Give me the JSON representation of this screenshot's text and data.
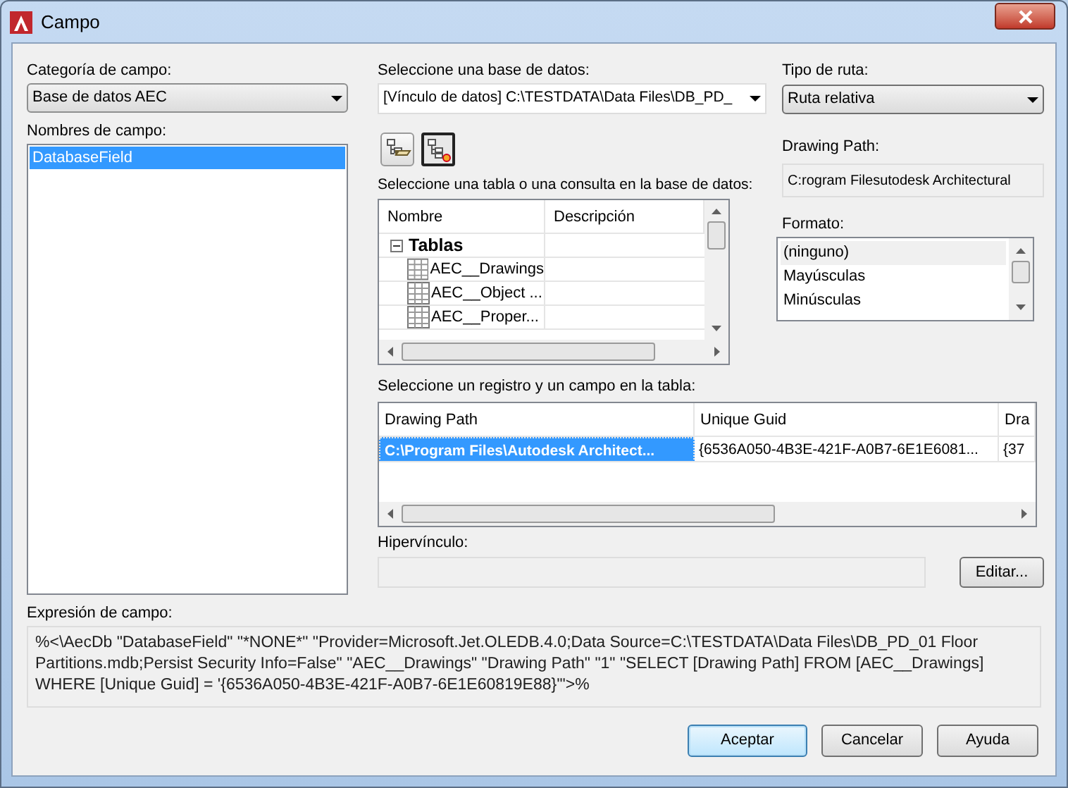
{
  "window": {
    "title": "Campo"
  },
  "field_category": {
    "label": "Categoría de campo:",
    "value": "Base de datos AEC"
  },
  "field_names": {
    "label": "Nombres de campo:",
    "items": [
      {
        "text": "DatabaseField",
        "selected": true
      }
    ]
  },
  "database": {
    "label": "Seleccione una base de datos:",
    "value": "[Vínculo de datos] C:\\TESTDATA\\Data Files\\DB_PD_"
  },
  "toolbar": [
    {
      "kind": "open",
      "pressed": false
    },
    {
      "kind": "new",
      "pressed": true
    }
  ],
  "table_query": {
    "label": "Seleccione una tabla o una consulta en la base de datos:",
    "columns": [
      "Nombre",
      "Descripción"
    ],
    "tree": [
      {
        "text": "Tablas",
        "expanded": true,
        "children": [
          {
            "text": "AEC__Drawings"
          },
          {
            "text": "AEC__Object ..."
          },
          {
            "text": "AEC__Proper..."
          }
        ]
      }
    ]
  },
  "path_type": {
    "label": "Tipo de ruta:",
    "value": "Ruta relativa"
  },
  "drawing_path": {
    "label": "Drawing Path:",
    "value": "C:rogram Filesutodesk Architectural"
  },
  "format": {
    "label": "Formato:",
    "items": [
      {
        "text": "(ninguno)",
        "selected": true
      },
      {
        "text": "Mayúsculas",
        "selected": false
      },
      {
        "text": "Minúsculas",
        "selected": false
      }
    ]
  },
  "record": {
    "label": "Seleccione un registro y un campo en la tabla:",
    "columns": [
      "Drawing Path",
      "Unique Guid",
      "Dra"
    ],
    "rows": [
      {
        "cells": [
          "C:\\Program Files\\Autodesk Architect...",
          "{6536A050-4B3E-421F-A0B7-6E1E6081...",
          "{37"
        ],
        "selected": true
      }
    ]
  },
  "hyperlink": {
    "label": "Hipervínculo:",
    "disabled": true,
    "button": "Editar..."
  },
  "expression": {
    "label": "Expresión de campo:",
    "text": "%<\\AecDb \"DatabaseField\" \"*NONE*\" \"Provider=Microsoft.Jet.OLEDB.4.0;Data Source=C:\\TESTDATA\\Data Files\\DB_PD_01 Floor Partitions.mdb;Persist Security Info=False\" \"AEC__Drawings\" \"Drawing Path\" \"1\" \"SELECT [Drawing Path] FROM [AEC__Drawings] WHERE [Unique Guid] = '{6536A050-4B3E-421F-A0B7-6E1E60819E88}'\">%"
  },
  "buttons": [
    {
      "label": "Aceptar",
      "default": true
    },
    {
      "label": "Cancelar",
      "default": false
    },
    {
      "label": "Ayuda",
      "default": false
    }
  ]
}
